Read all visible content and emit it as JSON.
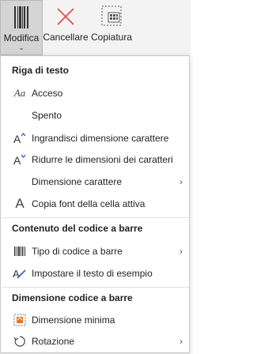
{
  "ribbon": {
    "buttons": [
      {
        "label": "Modifica",
        "icon": "barcode-icon"
      },
      {
        "label": "Cancellare",
        "icon": "delete-x-icon"
      },
      {
        "label": "Copiatura",
        "icon": "copy-icon"
      }
    ],
    "dropdown_chevron": "⌄"
  },
  "menu": {
    "section_text": "Riga di testo",
    "text_items": [
      {
        "label": "Acceso",
        "icon": "Aa"
      },
      {
        "label": "Spento",
        "icon": ""
      },
      {
        "label": "Ingrandisci dimensione carattere",
        "icon": "A^"
      },
      {
        "label": "Ridurre le dimensioni dei caratteri",
        "icon": "Av"
      },
      {
        "label": "Dimensione carattere",
        "icon": "",
        "submenu": "›"
      },
      {
        "label": "Copia font della cella attiva",
        "icon": "A"
      }
    ],
    "section_barcode": "Contenuto del codice a barre",
    "barcode_items": [
      {
        "label": "Tipo di codice a barre",
        "icon": "barcode-icon",
        "submenu": "›"
      },
      {
        "label": "Impostare il testo di esempio",
        "icon": "pen-text-icon"
      }
    ],
    "section_size": "Dimensione codice a barre",
    "size_items": [
      {
        "label": "Dimensione minima",
        "icon": "min-size-icon"
      },
      {
        "label": "Rotazione",
        "icon": "rotate-icon",
        "submenu": "›"
      }
    ]
  },
  "colors": {
    "accent_red": "#e0504a",
    "orange": "#e8731a",
    "blue": "#2b5fb0"
  }
}
